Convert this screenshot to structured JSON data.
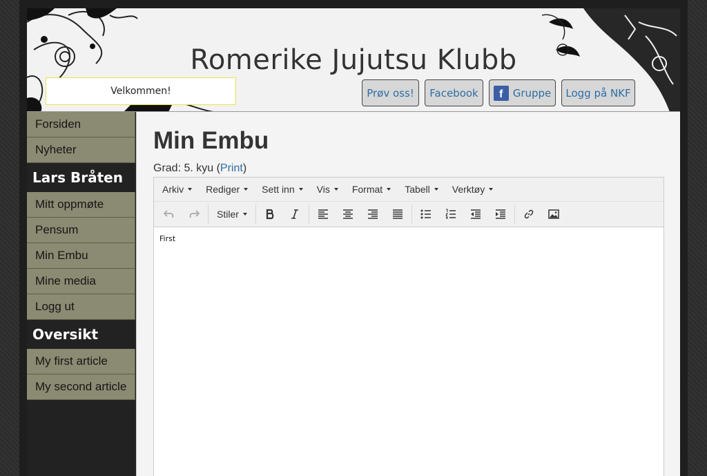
{
  "header": {
    "site_title": "Romerike Jujutsu Klubb",
    "welcome_text": "Velkommen!",
    "buttons": [
      {
        "label": "Prøv oss!"
      },
      {
        "label": "Facebook"
      },
      {
        "label": "Gruppe",
        "icon": "facebook-icon"
      },
      {
        "label": "Logg på NKF"
      }
    ]
  },
  "sidebar": {
    "main_items": [
      {
        "label": "Forsiden"
      },
      {
        "label": "Nyheter"
      }
    ],
    "user_heading": "Lars Bråten",
    "user_items": [
      {
        "label": "Mitt oppmøte"
      },
      {
        "label": "Pensum"
      },
      {
        "label": "Min Embu"
      },
      {
        "label": "Mine media"
      },
      {
        "label": "Logg ut"
      }
    ],
    "overview_heading": "Oversikt",
    "overview_items": [
      {
        "label": "My first article"
      },
      {
        "label": "My second article"
      }
    ]
  },
  "main": {
    "title": "Min Embu",
    "grade_prefix": "Grad: 5. kyu (",
    "print_link": "Print",
    "grade_suffix": ")"
  },
  "editor": {
    "menus": [
      "Arkiv",
      "Rediger",
      "Sett inn",
      "Vis",
      "Format",
      "Tabell",
      "Verktøy"
    ],
    "styles_label": "Stiler",
    "content": "First",
    "toolbar_icons": [
      "undo-icon",
      "redo-icon",
      "bold-icon",
      "italic-icon",
      "align-left-icon",
      "align-center-icon",
      "align-right-icon",
      "align-justify-icon",
      "bullet-list-icon",
      "numbered-list-icon",
      "outdent-icon",
      "indent-icon",
      "link-icon",
      "image-icon"
    ]
  },
  "colors": {
    "nav_bg": "#8b8a72",
    "link": "#2e6da4",
    "welcome_border": "#e8e24a"
  }
}
